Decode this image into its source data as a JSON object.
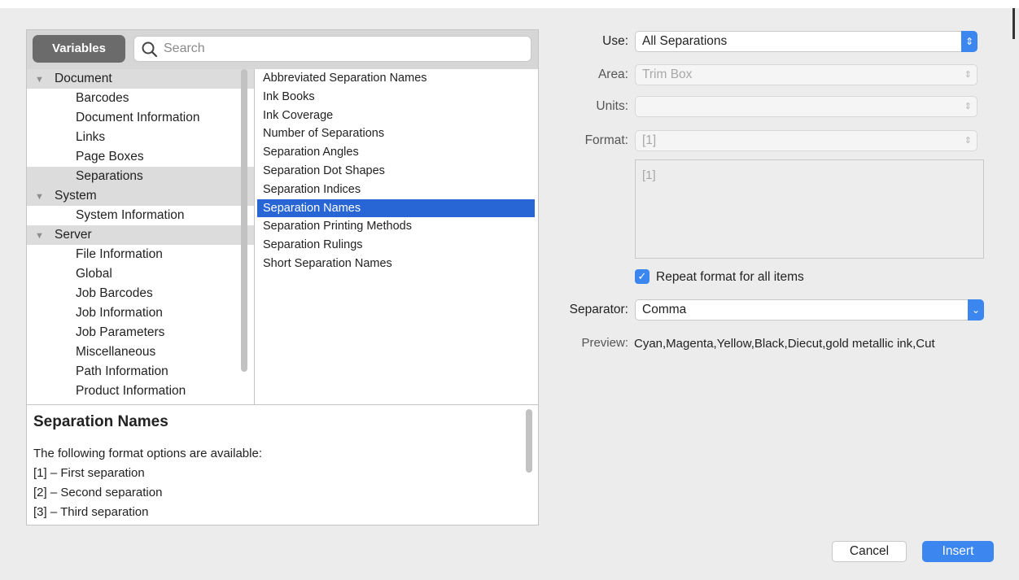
{
  "left_panel": {
    "variables_button": "Variables",
    "search_placeholder": "Search",
    "tree": [
      {
        "type": "category",
        "label": "Document"
      },
      {
        "type": "child",
        "label": "Barcodes"
      },
      {
        "type": "child",
        "label": "Document Information"
      },
      {
        "type": "child",
        "label": "Links"
      },
      {
        "type": "child",
        "label": "Page Boxes"
      },
      {
        "type": "child",
        "label": "Separations",
        "selected": true
      },
      {
        "type": "category",
        "label": "System"
      },
      {
        "type": "child",
        "label": "System Information"
      },
      {
        "type": "category",
        "label": "Server"
      },
      {
        "type": "child",
        "label": "File Information"
      },
      {
        "type": "child",
        "label": "Global"
      },
      {
        "type": "child",
        "label": "Job Barcodes"
      },
      {
        "type": "child",
        "label": "Job Information"
      },
      {
        "type": "child",
        "label": "Job Parameters"
      },
      {
        "type": "child",
        "label": "Miscellaneous"
      },
      {
        "type": "child",
        "label": "Path Information"
      },
      {
        "type": "child",
        "label": "Product Information"
      }
    ],
    "variables": [
      "Abbreviated Separation Names",
      "Ink Books",
      "Ink Coverage",
      "Number of Separations",
      "Separation Angles",
      "Separation Dot Shapes",
      "Separation Indices",
      "Separation Names",
      "Separation Printing Methods",
      "Separation Rulings",
      "Short Separation Names"
    ],
    "selected_variable": "Separation Names",
    "help": {
      "title": "Separation Names",
      "intro": "The following format options are available:",
      "options": [
        "[1]  –  First separation",
        "[2]  –  Second separation",
        "[3]  –  Third separation"
      ]
    }
  },
  "form": {
    "use": {
      "label": "Use:",
      "value": "All Separations"
    },
    "area": {
      "label": "Area:",
      "value": "Trim Box"
    },
    "units": {
      "label": "Units:",
      "value": ""
    },
    "format": {
      "label": "Format:",
      "value": "[1]"
    },
    "format_text": "[1]",
    "repeat_label": "Repeat format for all items",
    "repeat_checked": true,
    "separator": {
      "label": "Separator:",
      "value": "Comma"
    },
    "preview": {
      "label": "Preview:",
      "value": "Cyan,Magenta,Yellow,Black,Diecut,gold metallic ink,Cut"
    }
  },
  "buttons": {
    "cancel": "Cancel",
    "insert": "Insert"
  },
  "colors": {
    "accent": "#3c86f0",
    "selection": "#2866d6"
  }
}
